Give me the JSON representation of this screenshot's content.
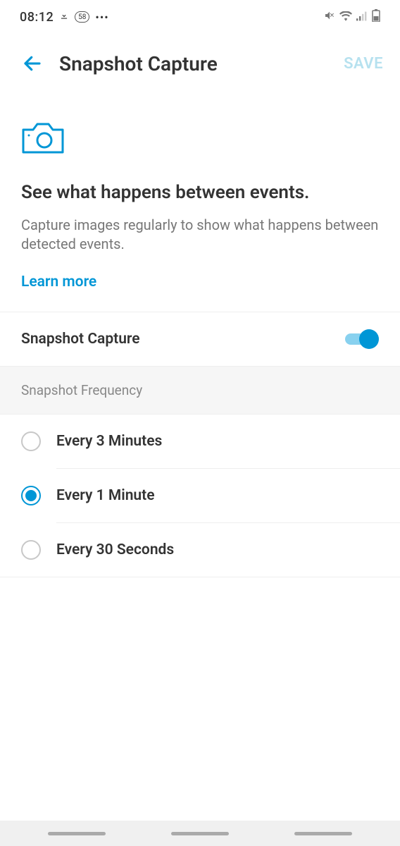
{
  "status": {
    "time": "08:12",
    "badge": "58"
  },
  "header": {
    "title": "Snapshot Capture",
    "save": "SAVE"
  },
  "intro": {
    "heading": "See what happens between events.",
    "description": "Capture images regularly to show what happens between detected events.",
    "learn_more": "Learn more"
  },
  "toggle": {
    "label": "Snapshot Capture",
    "value": true
  },
  "frequency": {
    "title": "Snapshot Frequency",
    "options": [
      {
        "label": "Every 3 Minutes",
        "selected": false
      },
      {
        "label": "Every 1 Minute",
        "selected": true
      },
      {
        "label": "Every 30 Seconds",
        "selected": false
      }
    ]
  }
}
